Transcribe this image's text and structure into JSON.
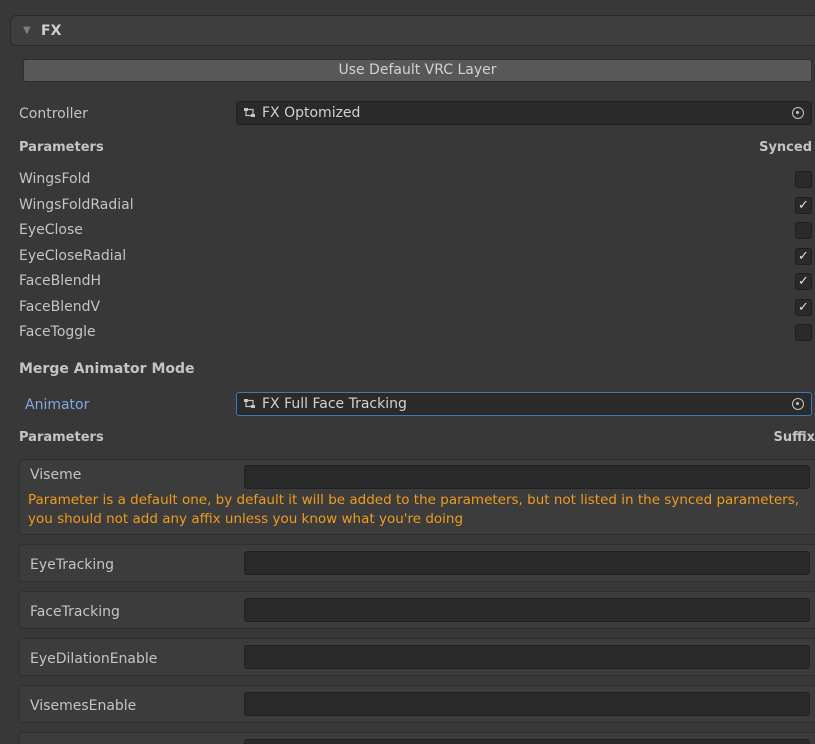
{
  "section": {
    "arrow_glyph": "▼",
    "title": "FX"
  },
  "default_button": {
    "label": "Use Default VRC Layer"
  },
  "controller": {
    "label": "Controller",
    "value": "FX Optomized",
    "icon": "animator-controller-icon"
  },
  "params_header": {
    "left": "Parameters",
    "right": "Synced"
  },
  "parameters": [
    {
      "name": "WingsFold",
      "synced": false
    },
    {
      "name": "WingsFoldRadial",
      "synced": true
    },
    {
      "name": "EyeClose",
      "synced": false
    },
    {
      "name": "EyeCloseRadial",
      "synced": true
    },
    {
      "name": "FaceBlendH",
      "synced": true
    },
    {
      "name": "FaceBlendV",
      "synced": true
    },
    {
      "name": "FaceToggle",
      "synced": false
    }
  ],
  "merge": {
    "title": "Merge Animator Mode"
  },
  "animator": {
    "label": "Animator",
    "value": "FX Full Face Tracking",
    "icon": "animator-controller-icon"
  },
  "suffix_header": {
    "left": "Parameters",
    "right": "Suffix"
  },
  "suffix_rows": [
    {
      "name": "Viseme",
      "value": "",
      "warning": "Parameter is a default one, by default it will be added to the parameters, but not listed in the synced parameters, you should not add any affix unless you know what you're doing"
    },
    {
      "name": "EyeTracking",
      "value": ""
    },
    {
      "name": "FaceTracking",
      "value": ""
    },
    {
      "name": "EyeDilationEnable",
      "value": ""
    },
    {
      "name": "VisemesEnable",
      "value": ""
    },
    {
      "name": "",
      "value": ""
    }
  ],
  "colors": {
    "background": "#383838",
    "field": "#2a2a2a",
    "warning": "#ef9b1e",
    "link": "#7fa8e0",
    "focus": "#3a79bb"
  }
}
